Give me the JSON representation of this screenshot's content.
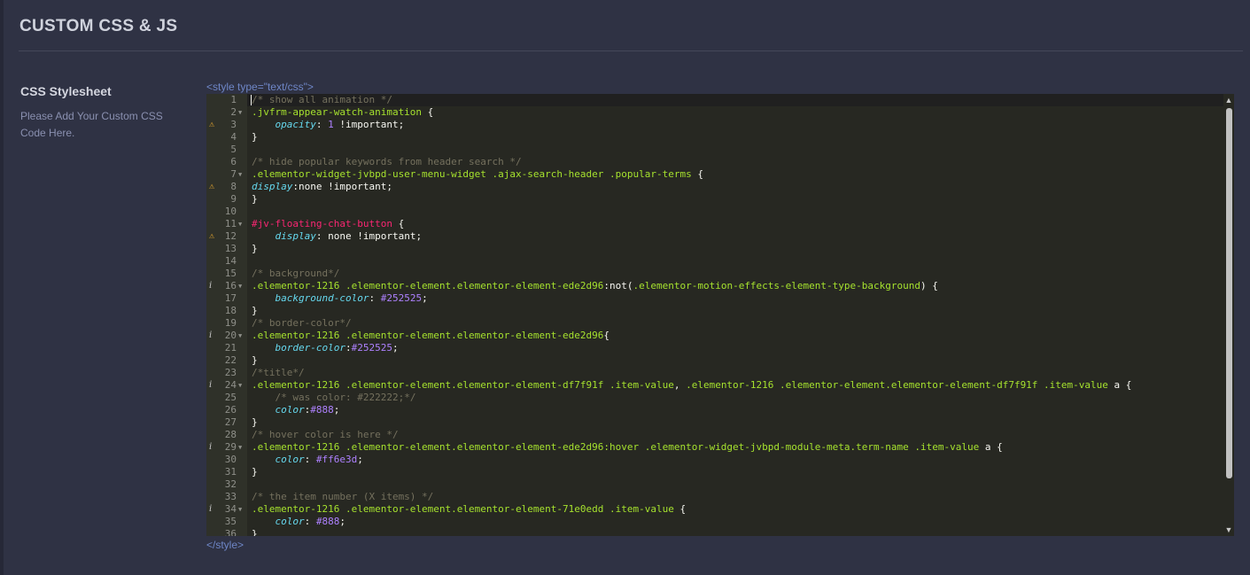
{
  "page": {
    "title": "CUSTOM CSS & JS"
  },
  "section": {
    "title": "CSS Stylesheet",
    "description": "Please Add Your Custom CSS Code Here."
  },
  "editor": {
    "open_tag": "<style type=\"text/css\">",
    "close_tag": "</style>",
    "colors": {
      "background": "#272822",
      "gutter": "#2f3129",
      "comment": "#75715e",
      "selector": "#a6e22e",
      "id_selector": "#f92672",
      "property": "#66d9ef",
      "value": "#ae81ff",
      "plain": "#f8f8f2",
      "warning_icon": "#e0a330"
    },
    "lines": [
      {
        "n": "1",
        "tokens": [
          {
            "t": "/* show all animation */",
            "c": "comment"
          }
        ]
      },
      {
        "n": "2",
        "fold": true,
        "tokens": [
          {
            "t": ".jvfrm-appear-watch-animation",
            "c": "selector"
          },
          {
            "t": " {",
            "c": "plain"
          }
        ]
      },
      {
        "n": "3",
        "marker": "warn",
        "tokens": [
          {
            "t": "    "
          },
          {
            "t": "opacity",
            "c": "property"
          },
          {
            "t": ": ",
            "c": "plain"
          },
          {
            "t": "1",
            "c": "value"
          },
          {
            "t": " !important;",
            "c": "plain"
          }
        ]
      },
      {
        "n": "4",
        "tokens": [
          {
            "t": "}",
            "c": "plain"
          }
        ]
      },
      {
        "n": "5",
        "tokens": []
      },
      {
        "n": "6",
        "tokens": [
          {
            "t": "/* hide popular keywords from header search */",
            "c": "comment"
          }
        ]
      },
      {
        "n": "7",
        "fold": true,
        "tokens": [
          {
            "t": ".elementor-widget-jvbpd-user-menu-widget .ajax-search-header .popular-terms",
            "c": "selector"
          },
          {
            "t": " {",
            "c": "plain"
          }
        ]
      },
      {
        "n": "8",
        "marker": "warn",
        "tokens": [
          {
            "t": "display",
            "c": "property"
          },
          {
            "t": ":",
            "c": "plain"
          },
          {
            "t": "none",
            "c": "plain"
          },
          {
            "t": " !important;",
            "c": "plain"
          }
        ]
      },
      {
        "n": "9",
        "tokens": [
          {
            "t": "}",
            "c": "plain"
          }
        ]
      },
      {
        "n": "10",
        "tokens": []
      },
      {
        "n": "11",
        "fold": true,
        "tokens": [
          {
            "t": "#jv-floating-chat-button",
            "c": "id_selector"
          },
          {
            "t": " {",
            "c": "plain"
          }
        ]
      },
      {
        "n": "12",
        "marker": "warn",
        "tokens": [
          {
            "t": "    "
          },
          {
            "t": "display",
            "c": "property"
          },
          {
            "t": ": none !important;",
            "c": "plain"
          }
        ]
      },
      {
        "n": "13",
        "tokens": [
          {
            "t": "}",
            "c": "plain"
          }
        ]
      },
      {
        "n": "14",
        "tokens": []
      },
      {
        "n": "15",
        "tokens": [
          {
            "t": "/* background*/",
            "c": "comment"
          }
        ]
      },
      {
        "n": "16",
        "fold": true,
        "marker": "info",
        "tokens": [
          {
            "t": ".elementor-1216 .elementor-element.elementor-element-ede2d96",
            "c": "selector"
          },
          {
            "t": ":not(",
            "c": "plain"
          },
          {
            "t": ".elementor-motion-effects-element-type-background",
            "c": "selector"
          },
          {
            "t": ") {",
            "c": "plain"
          }
        ]
      },
      {
        "n": "17",
        "tokens": [
          {
            "t": "    "
          },
          {
            "t": "background-color",
            "c": "property"
          },
          {
            "t": ": ",
            "c": "plain"
          },
          {
            "t": "#252525",
            "c": "value"
          },
          {
            "t": ";",
            "c": "plain"
          }
        ]
      },
      {
        "n": "18",
        "tokens": [
          {
            "t": "}",
            "c": "plain"
          }
        ]
      },
      {
        "n": "19",
        "tokens": [
          {
            "t": "/* border-color*/",
            "c": "comment"
          }
        ]
      },
      {
        "n": "20",
        "fold": true,
        "marker": "info",
        "tokens": [
          {
            "t": ".elementor-1216 .elementor-element.elementor-element-ede2d96",
            "c": "selector"
          },
          {
            "t": "{",
            "c": "plain"
          }
        ]
      },
      {
        "n": "21",
        "tokens": [
          {
            "t": "    "
          },
          {
            "t": "border-color",
            "c": "property"
          },
          {
            "t": ":",
            "c": "plain"
          },
          {
            "t": "#252525",
            "c": "value"
          },
          {
            "t": ";",
            "c": "plain"
          }
        ]
      },
      {
        "n": "22",
        "tokens": [
          {
            "t": "}",
            "c": "plain"
          }
        ]
      },
      {
        "n": "23",
        "tokens": [
          {
            "t": "/*title*/",
            "c": "comment"
          }
        ]
      },
      {
        "n": "24",
        "fold": true,
        "marker": "info",
        "tokens": [
          {
            "t": ".elementor-1216 .elementor-element.elementor-element-df7f91f .item-value",
            "c": "selector"
          },
          {
            "t": ", ",
            "c": "plain"
          },
          {
            "t": ".elementor-1216 .elementor-element.elementor-element-df7f91f .item-value",
            "c": "selector"
          },
          {
            "t": " a {",
            "c": "plain"
          }
        ]
      },
      {
        "n": "25",
        "tokens": [
          {
            "t": "    "
          },
          {
            "t": "/* was color: #222222;*/",
            "c": "comment"
          }
        ]
      },
      {
        "n": "26",
        "tokens": [
          {
            "t": "    "
          },
          {
            "t": "color",
            "c": "property"
          },
          {
            "t": ":",
            "c": "plain"
          },
          {
            "t": "#888",
            "c": "value"
          },
          {
            "t": ";",
            "c": "plain"
          }
        ]
      },
      {
        "n": "27",
        "tokens": [
          {
            "t": "}",
            "c": "plain"
          }
        ]
      },
      {
        "n": "28",
        "tokens": [
          {
            "t": "/* hover color is here */",
            "c": "comment"
          }
        ]
      },
      {
        "n": "29",
        "fold": true,
        "marker": "info",
        "tokens": [
          {
            "t": ".elementor-1216 .elementor-element.elementor-element-ede2d96",
            "c": "selector"
          },
          {
            "t": ":hover ",
            "c": "selector"
          },
          {
            "t": ".elementor-widget-jvbpd-module-meta.term-name .item-value",
            "c": "selector"
          },
          {
            "t": " a {",
            "c": "plain"
          }
        ]
      },
      {
        "n": "30",
        "tokens": [
          {
            "t": "    "
          },
          {
            "t": "color",
            "c": "property"
          },
          {
            "t": ": ",
            "c": "plain"
          },
          {
            "t": "#ff6e3d",
            "c": "value"
          },
          {
            "t": ";",
            "c": "plain"
          }
        ]
      },
      {
        "n": "31",
        "tokens": [
          {
            "t": "}",
            "c": "plain"
          }
        ]
      },
      {
        "n": "32",
        "tokens": []
      },
      {
        "n": "33",
        "tokens": [
          {
            "t": "/* the item number (X items) */",
            "c": "comment"
          }
        ]
      },
      {
        "n": "34",
        "fold": true,
        "marker": "info",
        "tokens": [
          {
            "t": ".elementor-1216 .elementor-element.elementor-element-71e0edd .item-value",
            "c": "selector"
          },
          {
            "t": " {",
            "c": "plain"
          }
        ]
      },
      {
        "n": "35",
        "tokens": [
          {
            "t": "    "
          },
          {
            "t": "color",
            "c": "property"
          },
          {
            "t": ": ",
            "c": "plain"
          },
          {
            "t": "#888",
            "c": "value"
          },
          {
            "t": ";",
            "c": "plain"
          }
        ]
      },
      {
        "n": "36",
        "tokens": [
          {
            "t": "}",
            "c": "plain"
          }
        ]
      }
    ]
  }
}
